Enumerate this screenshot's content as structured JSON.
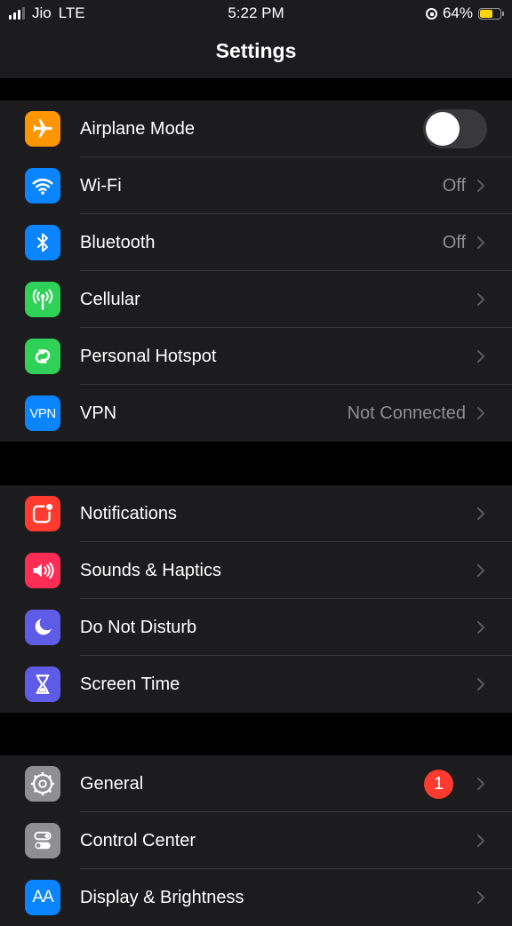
{
  "status_bar": {
    "carrier": "Jio",
    "network": "LTE",
    "time": "5:22 PM",
    "battery": "64%",
    "battery_level": 0.64,
    "battery_color": "#ffd60a"
  },
  "nav": {
    "title": "Settings"
  },
  "groups": [
    {
      "rows": [
        {
          "label": "Airplane Mode",
          "icon": "airplane-icon",
          "icon_bg": "#ff9500",
          "toggle_on": false
        },
        {
          "label": "Wi-Fi",
          "icon": "wifi-icon",
          "icon_bg": "#0a84ff",
          "value": "Off"
        },
        {
          "label": "Bluetooth",
          "icon": "bluetooth-icon",
          "icon_bg": "#0a84ff",
          "value": "Off"
        },
        {
          "label": "Cellular",
          "icon": "cellular-icon",
          "icon_bg": "#30d158"
        },
        {
          "label": "Personal Hotspot",
          "icon": "hotspot-icon",
          "icon_bg": "#30d158"
        },
        {
          "label": "VPN",
          "icon": "vpn-icon",
          "icon_text": "VPN",
          "icon_bg": "#0a84ff",
          "value": "Not Connected"
        }
      ]
    },
    {
      "rows": [
        {
          "label": "Notifications",
          "icon": "notifications-icon",
          "icon_bg": "#ff3b30"
        },
        {
          "label": "Sounds & Haptics",
          "icon": "speaker-icon",
          "icon_bg": "#ff2d55"
        },
        {
          "label": "Do Not Disturb",
          "icon": "moon-icon",
          "icon_bg": "#5e5ce6"
        },
        {
          "label": "Screen Time",
          "icon": "hourglass-icon",
          "icon_bg": "#5e5ce6"
        }
      ]
    },
    {
      "rows": [
        {
          "label": "General",
          "icon": "gear-icon",
          "icon_bg": "#8e8e93",
          "badge": "1"
        },
        {
          "label": "Control Center",
          "icon": "switches-icon",
          "icon_bg": "#8e8e93"
        },
        {
          "label": "Display & Brightness",
          "icon": "text-size-icon",
          "icon_text": "AA",
          "icon_bg": "#0a84ff"
        }
      ]
    }
  ]
}
